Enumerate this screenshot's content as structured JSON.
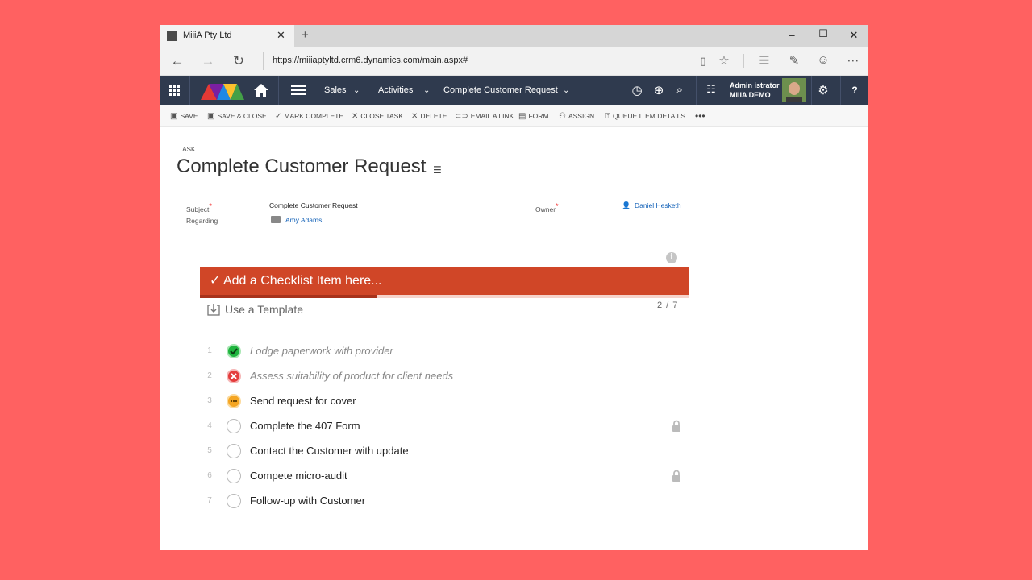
{
  "browser": {
    "tab_title": "MiiiA Pty Ltd",
    "url": "https://miiiaptyltd.crm6.dynamics.com/main.aspx#"
  },
  "crm_nav": {
    "area": "Sales",
    "entity": "Activities",
    "record": "Complete Customer Request",
    "user_name": "Admin istrator",
    "user_org": "MiiiA DEMO",
    "help": "?"
  },
  "commands": [
    {
      "label": "SAVE",
      "icon": "save-icon"
    },
    {
      "label": "SAVE & CLOSE",
      "icon": "save-close-icon"
    },
    {
      "label": "MARK COMPLETE",
      "icon": "check-icon"
    },
    {
      "label": "CLOSE TASK",
      "icon": "close-icon"
    },
    {
      "label": "DELETE",
      "icon": "delete-icon"
    },
    {
      "label": "EMAIL A LINK",
      "icon": "link-icon"
    },
    {
      "label": "FORM",
      "icon": "form-icon"
    },
    {
      "label": "ASSIGN",
      "icon": "assign-icon"
    },
    {
      "label": "QUEUE ITEM DETAILS",
      "icon": "queue-icon"
    }
  ],
  "form": {
    "entity_type": "TASK",
    "title": "Complete Customer Request",
    "subject_label": "Subject",
    "subject_value": "Complete Customer Request",
    "regarding_label": "Regarding",
    "regarding_value": "Amy Adams",
    "owner_label": "Owner",
    "owner_value": "Daniel Hesketh",
    "required_mark": "*"
  },
  "checklist": {
    "add_placeholder": "✓ Add a Checklist Item here...",
    "template_label": "Use a Template",
    "progress_text": "2 / 7",
    "progress_fraction": 0.36,
    "items": [
      {
        "num": "1",
        "text": "Lodge paperwork with provider",
        "status": "done"
      },
      {
        "num": "2",
        "text": "Assess suitability of product for client needs",
        "status": "failed"
      },
      {
        "num": "3",
        "text": "Send request for cover",
        "status": "progress"
      },
      {
        "num": "4",
        "text": "Complete the 407 Form",
        "status": "todo",
        "locked": true
      },
      {
        "num": "5",
        "text": "Contact the Customer with update",
        "status": "todo"
      },
      {
        "num": "6",
        "text": "Compete micro-audit",
        "status": "todo",
        "locked": true
      },
      {
        "num": "7",
        "text": "Follow-up with Customer",
        "status": "todo"
      }
    ]
  },
  "colors": {
    "page_bg": "#ff6161",
    "nav_bg": "#2f3a4e",
    "accent": "#d04627",
    "link": "#1160b7"
  }
}
